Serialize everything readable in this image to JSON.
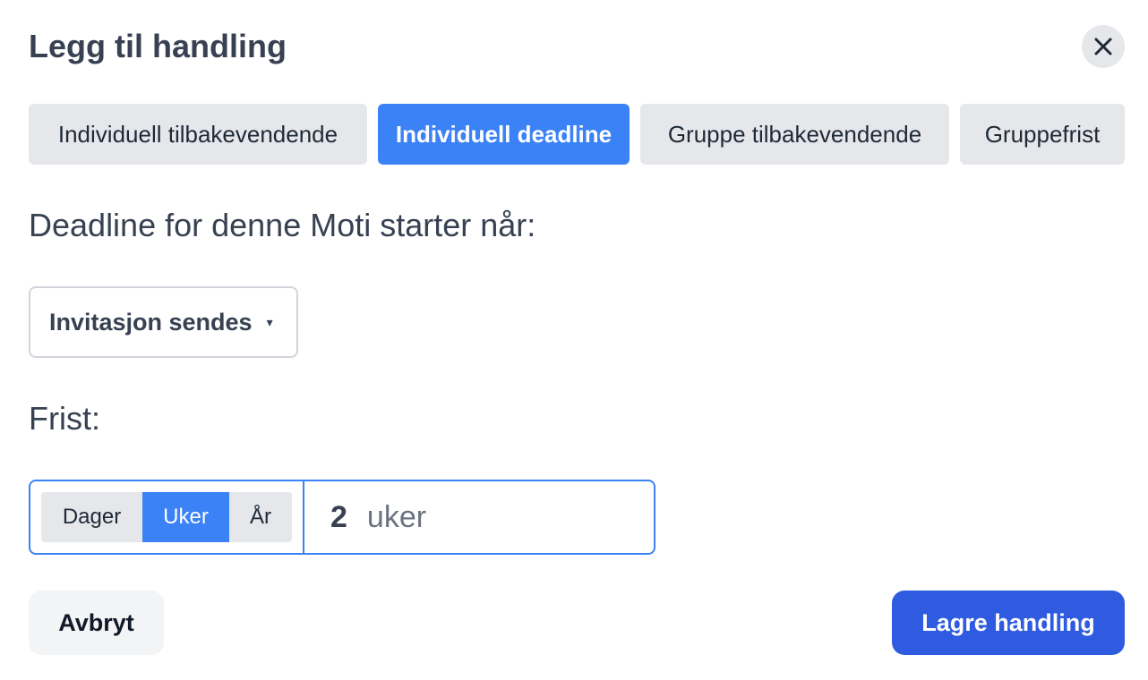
{
  "dialog": {
    "title": "Legg til handling",
    "close_icon": "close-icon"
  },
  "tabs": [
    {
      "label": "Individuell tilbakevendende",
      "active": false
    },
    {
      "label": "Individuell deadline",
      "active": true
    },
    {
      "label": "Gruppe tilbakevendende",
      "active": false
    },
    {
      "label": "Gruppefrist",
      "active": false
    }
  ],
  "deadline": {
    "label": "Deadline for denne Moti starter når:",
    "select_value": "Invitasjon sendes",
    "caret": "▾"
  },
  "frist": {
    "label": "Frist:",
    "units": [
      {
        "label": "Dager",
        "active": false
      },
      {
        "label": "Uker",
        "active": true
      },
      {
        "label": "År",
        "active": false
      }
    ],
    "amount": "2",
    "unit_suffix": "uker"
  },
  "footer": {
    "cancel_label": "Avbryt",
    "save_label": "Lagre handling"
  },
  "colors": {
    "accent": "#3b82f6",
    "primary_button": "#2f5be0",
    "neutral": "#e5e7eb"
  }
}
